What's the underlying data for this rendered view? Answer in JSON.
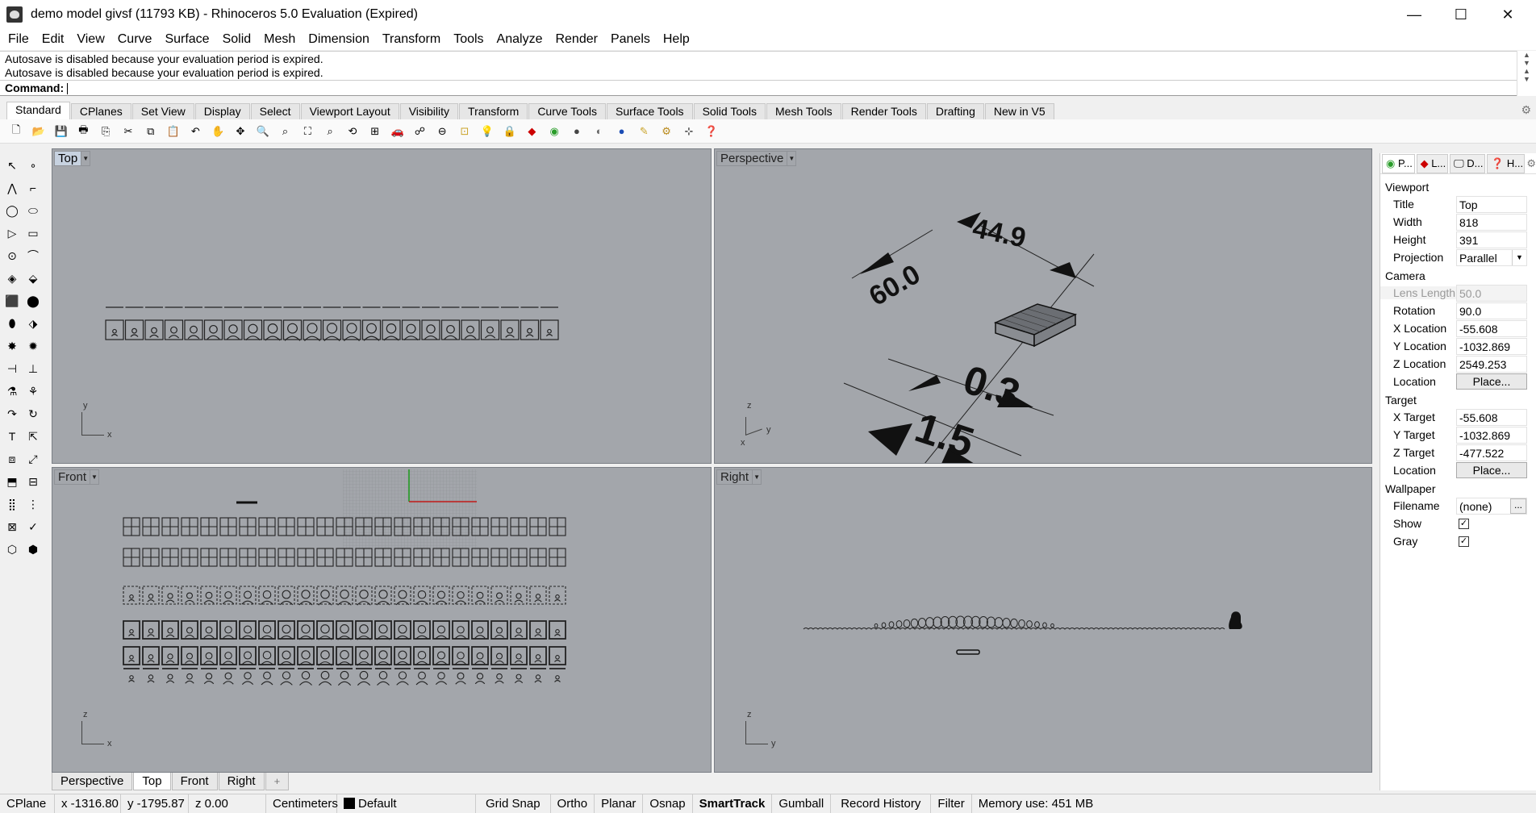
{
  "window": {
    "title": "demo model givsf (11793 KB) - Rhinoceros 5.0 Evaluation (Expired)",
    "minimize_glyph": "—",
    "maximize_glyph": "☐",
    "close_glyph": "✕"
  },
  "menu": [
    "File",
    "Edit",
    "View",
    "Curve",
    "Surface",
    "Solid",
    "Mesh",
    "Dimension",
    "Transform",
    "Tools",
    "Analyze",
    "Render",
    "Panels",
    "Help"
  ],
  "command": {
    "history": [
      "Autosave is disabled because your evaluation period is expired.",
      "Autosave is disabled because your evaluation period is expired."
    ],
    "prompt": "Command:"
  },
  "toolbar_tabs": [
    "Standard",
    "CPlanes",
    "Set View",
    "Display",
    "Select",
    "Viewport Layout",
    "Visibility",
    "Transform",
    "Curve Tools",
    "Surface Tools",
    "Solid Tools",
    "Mesh Tools",
    "Render Tools",
    "Drafting",
    "New in V5"
  ],
  "viewports": {
    "top": {
      "label": "Top",
      "axis_x": "x",
      "axis_y": "y"
    },
    "perspective": {
      "label": "Perspective",
      "axis_x": "y",
      "axis_y": "z",
      "axis_z": "x",
      "dims": [
        "60.0",
        "44.9",
        "0.3",
        "1.5"
      ]
    },
    "front": {
      "label": "Front",
      "axis_x": "x",
      "axis_y": "z"
    },
    "right": {
      "label": "Right",
      "axis_x": "y",
      "axis_y": "z"
    }
  },
  "viewport_tabs": [
    "Perspective",
    "Top",
    "Front",
    "Right"
  ],
  "viewport_tab_add": "+",
  "status": {
    "cplane": "CPlane",
    "x": "x -1316.80",
    "y": "y -1795.87",
    "z": "z 0.00",
    "units": "Centimeters",
    "layer": "Default",
    "grid_snap": "Grid Snap",
    "ortho": "Ortho",
    "planar": "Planar",
    "osnap": "Osnap",
    "smarttrack": "SmartTrack",
    "gumball": "Gumball",
    "record_history": "Record History",
    "filter": "Filter",
    "memory": "Memory use: 451 MB"
  },
  "panel": {
    "tabs": [
      "P...",
      "L...",
      "D...",
      "H..."
    ],
    "viewport_section": "Viewport",
    "title_label": "Title",
    "title_value": "Top",
    "width_label": "Width",
    "width_value": "818",
    "height_label": "Height",
    "height_value": "391",
    "projection_label": "Projection",
    "projection_value": "Parallel",
    "camera_section": "Camera",
    "lens_label": "Lens Length",
    "lens_value": "50.0",
    "rotation_label": "Rotation",
    "rotation_value": "90.0",
    "xloc_label": "X Location",
    "xloc_value": "-55.608",
    "yloc_label": "Y Location",
    "yloc_value": "-1032.869",
    "zloc_label": "Z Location",
    "zloc_value": "2549.253",
    "location_label": "Location",
    "place_button": "Place...",
    "target_section": "Target",
    "xt_label": "X Target",
    "xt_value": "-55.608",
    "yt_label": "Y Target",
    "yt_value": "-1032.869",
    "zt_label": "Z Target",
    "zt_value": "-477.522",
    "tlocation_label": "Location",
    "tplace_button": "Place...",
    "wallpaper_section": "Wallpaper",
    "filename_label": "Filename",
    "filename_value": "(none)",
    "filename_button": "...",
    "show_label": "Show",
    "show_checked": true,
    "gray_label": "Gray",
    "gray_checked": true,
    "check_glyph": "✓"
  }
}
